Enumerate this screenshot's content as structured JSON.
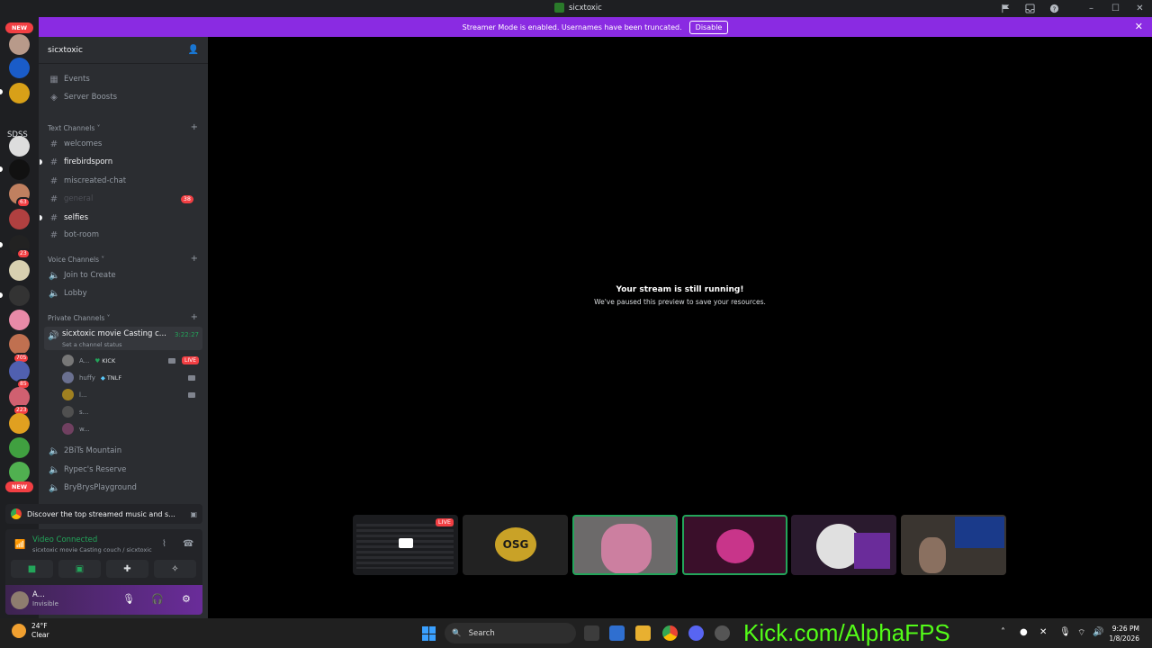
{
  "window": {
    "title": "sicxtoxic"
  },
  "banner": {
    "message": "Streamer Mode is enabled. Usernames have been truncated.",
    "disable_label": "Disable",
    "color": "#8a2be2"
  },
  "rail": {
    "new_badge_top": "NEW",
    "new_badge_bottom": "NEW",
    "folder_label": "SDSS",
    "badges": [
      "63",
      "23",
      "705",
      "85",
      "223"
    ]
  },
  "server": {
    "name": "sicxtoxic",
    "events_label": "Events",
    "boosts_label": "Server Boosts",
    "text_category": "Text Channels",
    "text_channels": [
      {
        "name": "welcomes"
      },
      {
        "name": "firebirdsporn"
      },
      {
        "name": "miscreated-chat"
      },
      {
        "name": "general",
        "badge": "38"
      },
      {
        "name": "selfies"
      },
      {
        "name": "bot-room"
      }
    ],
    "voice_category": "Voice Channels",
    "voice_channels": [
      "Join to Create",
      "Lobby"
    ],
    "private_category": "Private Channels",
    "active_channel": {
      "name": "sicxtoxic movie Casting c...",
      "status": "Set a channel status",
      "elapsed": "3:22:27"
    },
    "participants": [
      {
        "name": "A...",
        "tag": "KICK",
        "live": "LIVE"
      },
      {
        "name": "huffy",
        "tag": "TNLF"
      },
      {
        "name": "l..."
      },
      {
        "name": "s..."
      },
      {
        "name": "w..."
      }
    ],
    "other_voice": [
      "2BiTs Mountain",
      "Rypec's Reserve",
      "BryBrysPlayground"
    ]
  },
  "promo": {
    "text": "Discover the top streamed music and s..."
  },
  "voice_panel": {
    "status": "Video Connected",
    "channel": "sicxtoxic movie Casting couch / sicxtoxic"
  },
  "user_panel": {
    "name": "A...",
    "status": "Invisible"
  },
  "stage": {
    "title": "Your stream is still running!",
    "subtitle": "We've paused this preview to save your resources.",
    "tile_live": "LIVE",
    "tile_logo": "OSG"
  },
  "taskbar": {
    "temp": "24°F",
    "condition": "Clear",
    "search": "Search",
    "overlay": "Kick.com/AlphaFPS",
    "time": "9:26 PM",
    "date": "1/8/2026"
  }
}
